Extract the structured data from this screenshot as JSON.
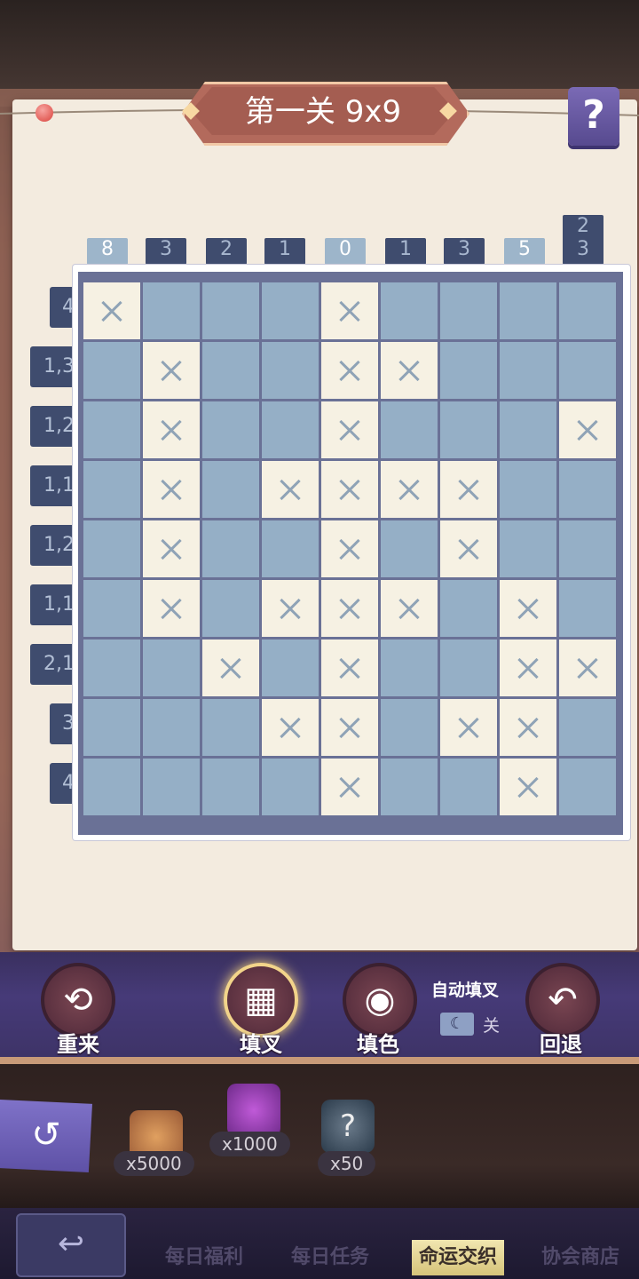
{
  "title": "第一关 9x9",
  "help_label": "?",
  "col_clues": [
    [
      "8"
    ],
    [
      "3"
    ],
    [
      "2"
    ],
    [
      "1"
    ],
    [
      "0"
    ],
    [
      "1"
    ],
    [
      "3"
    ],
    [
      "5"
    ],
    [
      "2",
      "3"
    ]
  ],
  "col_done": [
    true,
    false,
    false,
    false,
    true,
    false,
    false,
    true,
    false
  ],
  "row_clues": [
    "4",
    "1,3",
    "1,2",
    "1,1",
    "1,2",
    "1,1",
    "2,1",
    "3",
    "4"
  ],
  "grid": [
    "x...x....",
    ".x..xx...",
    ".x..x...x",
    ".x.xxxx..",
    ".x..x.x..",
    ".x.xxx.x.",
    "..x.x..xx",
    "...xx.xx.",
    "....x..x."
  ],
  "tools": {
    "restart": {
      "label": "重来",
      "icon": "restart-icon"
    },
    "fill_x": {
      "label": "填叉",
      "icon": "cross-grid-icon",
      "active": true
    },
    "fill_color": {
      "label": "填色",
      "icon": "palette-icon"
    },
    "undo": {
      "label": "回退",
      "icon": "undo-icon"
    }
  },
  "auto_fill": {
    "label": "自动填叉",
    "state": "关"
  },
  "rewards": [
    {
      "icon": "wing-badge-icon",
      "count": "x5000"
    },
    {
      "icon": "puzzle-piece-icon",
      "count": "x1000"
    },
    {
      "icon": "mystery-box-icon",
      "count": "x50"
    }
  ],
  "nav": {
    "tabs": [
      "每日福利",
      "每日任务",
      "命运交织",
      "协会商店"
    ],
    "active": "命运交织"
  },
  "colors": {
    "paper": "#f3ebdf",
    "filled_cell": "#95afc6",
    "crossed_cell": "#f6f1e3",
    "clue_bg": "#3f4c6e"
  }
}
